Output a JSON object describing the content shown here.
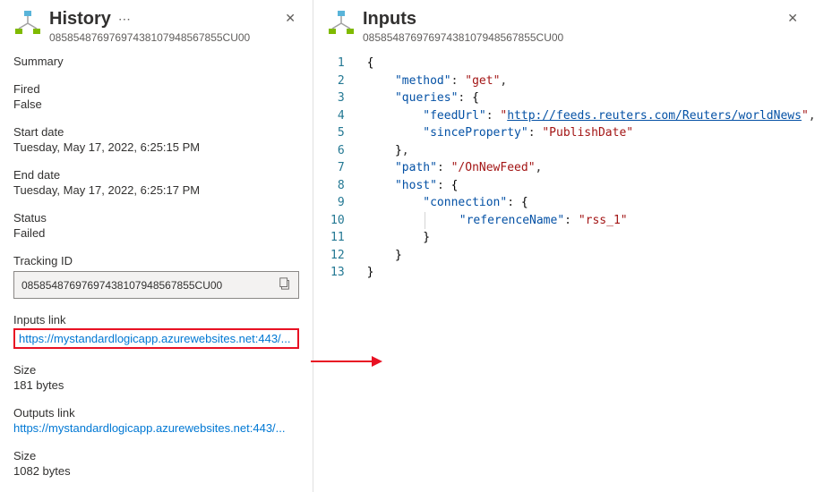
{
  "history": {
    "title": "History",
    "id": "08585487697697438107948567855CU00",
    "summary_label": "Summary",
    "fired_label": "Fired",
    "fired_value": "False",
    "start_label": "Start date",
    "start_value": "Tuesday, May 17, 2022, 6:25:15 PM",
    "end_label": "End date",
    "end_value": "Tuesday, May 17, 2022, 6:25:17 PM",
    "status_label": "Status",
    "status_value": "Failed",
    "tracking_label": "Tracking ID",
    "tracking_value": "08585487697697438107948567855CU00",
    "inputs_link_label": "Inputs link",
    "inputs_link_value": "https://mystandardlogicapp.azurewebsites.net:443/...",
    "inputs_size_label": "Size",
    "inputs_size_value": "181 bytes",
    "outputs_link_label": "Outputs link",
    "outputs_link_value": "https://mystandardlogicapp.azurewebsites.net:443/...",
    "outputs_size_label": "Size",
    "outputs_size_value": "1082 bytes"
  },
  "inputs": {
    "title": "Inputs",
    "id": "08585487697697438107948567855CU00",
    "json": {
      "method": "get",
      "queries": {
        "feedUrl": "http://feeds.reuters.com/Reuters/worldNews",
        "sinceProperty": "PublishDate"
      },
      "path": "/OnNewFeed",
      "host": {
        "connection": {
          "referenceName": "rss_1"
        }
      }
    }
  },
  "chart_data": null
}
